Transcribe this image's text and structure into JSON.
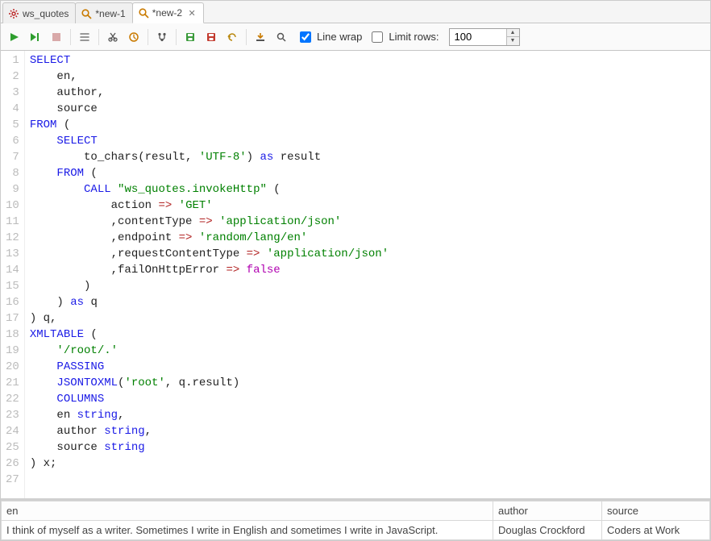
{
  "tabs": [
    {
      "label": "ws_quotes",
      "icon": "gear",
      "active": false,
      "closable": false
    },
    {
      "label": "*new-1",
      "icon": "magnify",
      "active": false,
      "closable": false
    },
    {
      "label": "*new-2",
      "icon": "magnify",
      "active": true,
      "closable": true
    }
  ],
  "toolbar": {
    "line_wrap_label": "Line wrap",
    "line_wrap_checked": true,
    "limit_rows_label": "Limit rows:",
    "limit_rows_checked": false,
    "limit_rows_value": "100"
  },
  "code_lines": [
    "<span class='kw'>SELECT</span>",
    "    en,",
    "    author,",
    "    source",
    "<span class='kw'>FROM</span> (",
    "    <span class='kw'>SELECT</span>",
    "        to_chars(result, <span class='str'>'UTF-8'</span>) <span class='kw'>as</span> result",
    "    <span class='kw'>FROM</span> (",
    "        <span class='kw'>CALL</span> <span class='str'>\"ws_quotes.invokeHttp\"</span> (",
    "            action <span class='op'>=&gt;</span> <span class='str'>'GET'</span>",
    "            ,contentType <span class='op'>=&gt;</span> <span class='str'>'application/json'</span>",
    "            ,endpoint <span class='op'>=&gt;</span> <span class='str'>'random/lang/en'</span>",
    "            ,requestContentType <span class='op'>=&gt;</span> <span class='str'>'application/json'</span>",
    "            ,failOnHttpError <span class='op'>=&gt;</span> <span class='bool-lit'>false</span>",
    "        )",
    "    ) <span class='kw'>as</span> q",
    ") q,",
    "<span class='fn'>XMLTABLE</span> (",
    "    <span class='str'>'/root/.'</span>",
    "    <span class='kw'>PASSING</span>",
    "    <span class='fn'>JSONTOXML</span>(<span class='str'>'root'</span>, q.result)",
    "    <span class='kw'>COLUMNS</span>",
    "    en <span class='kw'>string</span>,",
    "    author <span class='kw'>string</span>,",
    "    source <span class='kw'>string</span>",
    ") x;",
    ""
  ],
  "results": {
    "columns": [
      "en",
      "author",
      "source"
    ],
    "rows": [
      [
        "I think of myself as a writer. Sometimes I write in English and sometimes I write in JavaScript.",
        "Douglas Crockford",
        "Coders at Work"
      ]
    ]
  }
}
